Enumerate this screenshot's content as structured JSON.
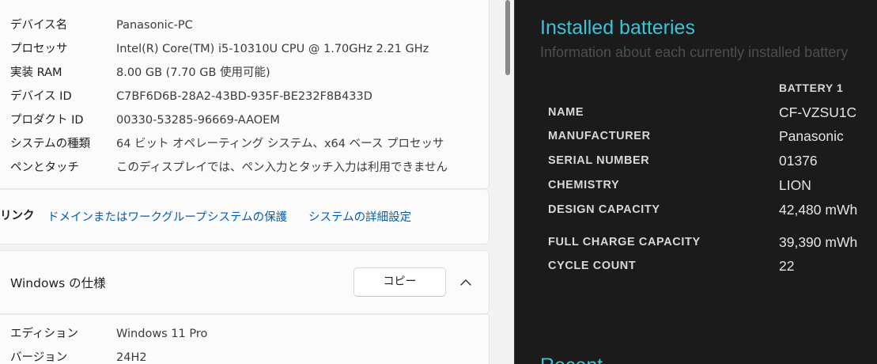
{
  "settings": {
    "device_specs": [
      {
        "label": "デバイス名",
        "value": "Panasonic-PC"
      },
      {
        "label": "プロセッサ",
        "value": "Intel(R) Core(TM) i5-10310U CPU @ 1.70GHz   2.21 GHz"
      },
      {
        "label": "実装 RAM",
        "value": "8.00 GB (7.70 GB 使用可能)"
      },
      {
        "label": "デバイス ID",
        "value": "C7BF6D6B-28A2-43BD-935F-BE232F8B433D"
      },
      {
        "label": "プロダクト ID",
        "value": "00330-53285-96669-AAOEM"
      },
      {
        "label": "システムの種類",
        "value": "64 ビット オペレーティング システム、x64 ベース プロセッサ"
      },
      {
        "label": "ペンとタッチ",
        "value": "このディスプレイでは、ペン入力とタッチ入力は利用できません"
      }
    ],
    "related_links": {
      "label": "リンク",
      "items": [
        "ドメインまたはワークグループ",
        "システムの保護",
        "システムの詳細設定"
      ]
    },
    "windows_specs": {
      "title": "Windows の仕様",
      "copy_label": "コピー",
      "rows": [
        {
          "label": "エディション",
          "value": "Windows 11 Pro"
        },
        {
          "label": "バージョン",
          "value": "24H2"
        }
      ]
    }
  },
  "battery_report": {
    "title": "Installed batteries",
    "subtitle": "Information about each currently installed battery",
    "column_header": "BATTERY 1",
    "rows": [
      {
        "key": "NAME",
        "value": "CF-VZSU1C"
      },
      {
        "key": "MANUFACTURER",
        "value": "Panasonic"
      },
      {
        "key": "SERIAL NUMBER",
        "value": "01376"
      },
      {
        "key": "CHEMISTRY",
        "value": "LION"
      },
      {
        "key": "DESIGN CAPACITY",
        "value": "42,480 mWh"
      },
      {
        "key": "FULL CHARGE CAPACITY",
        "value": "39,390 mWh"
      },
      {
        "key": "CYCLE COUNT",
        "value": "22"
      }
    ],
    "next_heading_partial": "Recent"
  },
  "colors": {
    "settings_bg": "#f3f3f3",
    "card_bg": "#fbfbfb",
    "link": "#005fb8",
    "report_bg": "#1b1b1b",
    "report_accent": "#3ec2d6"
  }
}
